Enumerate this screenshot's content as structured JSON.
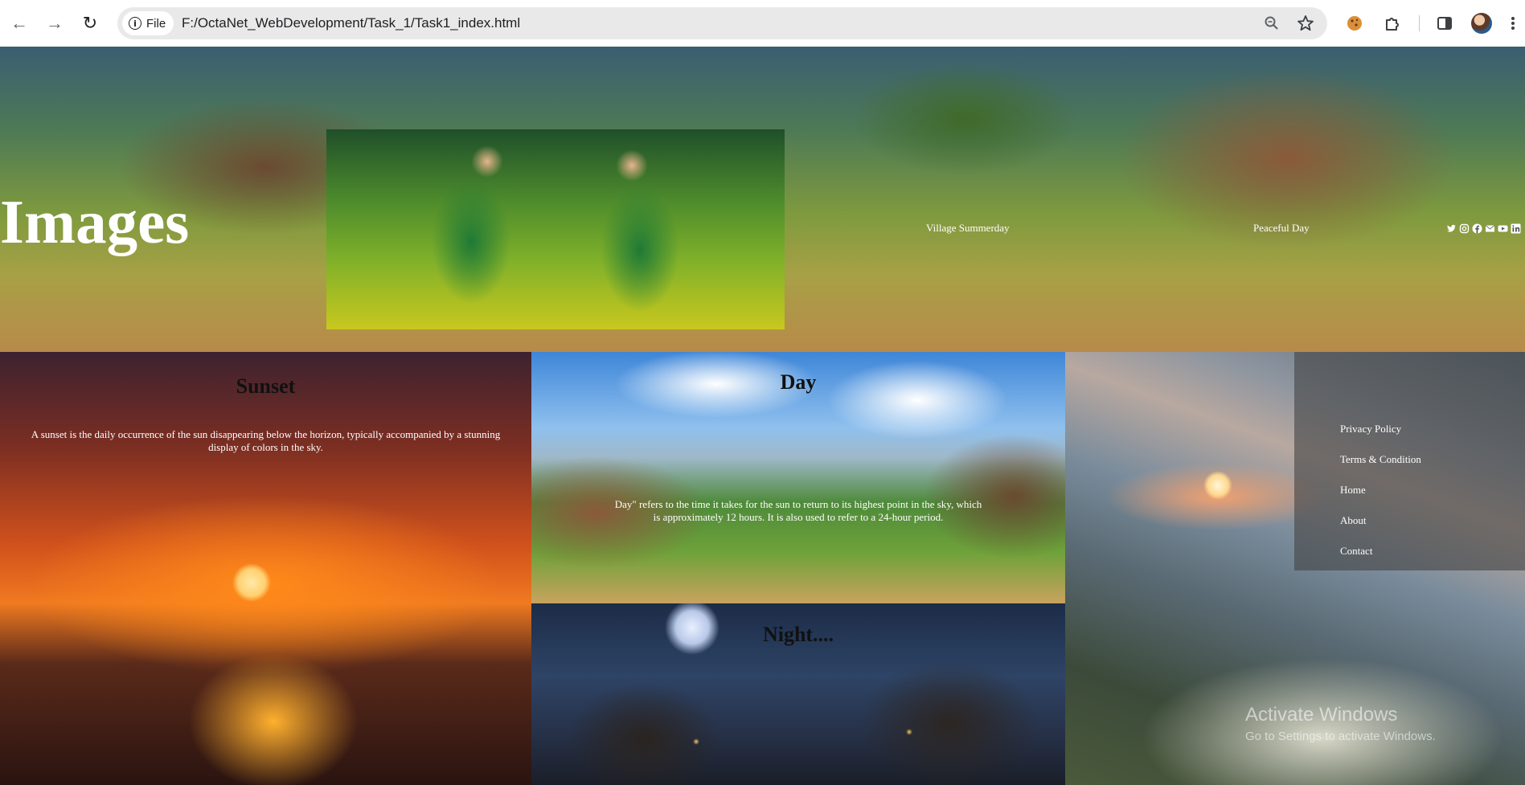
{
  "browser": {
    "back_glyph": "←",
    "forward_glyph": "→",
    "reload_glyph": "↻",
    "info_glyph": "i",
    "scheme_label": "File",
    "url": "F:/OctaNet_WebDevelopment/Task_1/Task1_index.html",
    "icons": [
      "zoom-icon",
      "bookmark-star-icon",
      "cookie-extension-icon",
      "extensions-puzzle-icon",
      "side-panel-icon",
      "profile-avatar",
      "menu-dots-icon"
    ]
  },
  "hero": {
    "title": "Images",
    "caption_left": "Village Summerday",
    "caption_right": "Peaceful Day",
    "social_icons": [
      "twitter-icon",
      "instagram-icon",
      "facebook-icon",
      "mail-icon",
      "youtube-icon",
      "linkedin-icon"
    ]
  },
  "cards": {
    "sunset": {
      "title": "Sunset",
      "text": "A sunset is the daily occurrence of the sun disappearing below the horizon, typically accompanied by a stunning display of colors in the sky."
    },
    "day": {
      "title": "Day",
      "text": "Day\" refers to the time it takes for the sun to return to its highest point in the sky, which is approximately 12 hours. It is also used to refer to a 24-hour period."
    },
    "night": {
      "title": "Night...."
    }
  },
  "footer_menu": {
    "items": [
      "Privacy Policy",
      "Terms & Condition",
      "Home",
      "About",
      "Contact"
    ]
  },
  "watermark": {
    "line1": "Activate Windows",
    "line2": "Go to Settings to activate Windows."
  }
}
